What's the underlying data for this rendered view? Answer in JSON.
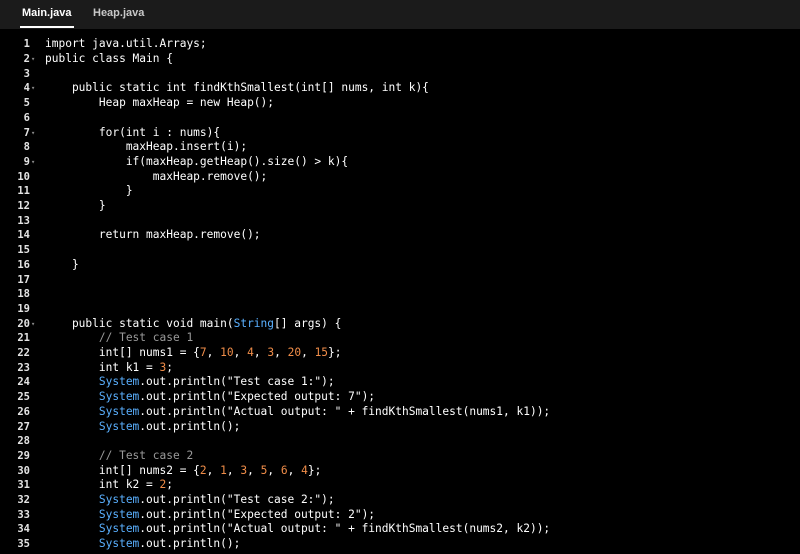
{
  "tabs": [
    {
      "label": "Main.java",
      "active": true
    },
    {
      "label": "Heap.java",
      "active": false
    }
  ],
  "colors": {
    "background": "#000000",
    "tabbar": "#1b1b1b",
    "number": "#f08d49",
    "type": "#5ab0ff",
    "comment": "#9a9a9a"
  },
  "editor": {
    "lines": [
      {
        "n": "1",
        "fold": false,
        "tokens": [
          [
            "plain",
            "import java.util.Arrays;"
          ]
        ]
      },
      {
        "n": "2",
        "fold": true,
        "tokens": [
          [
            "plain",
            "public class Main {"
          ]
        ]
      },
      {
        "n": "3",
        "fold": false,
        "tokens": []
      },
      {
        "n": "4",
        "fold": true,
        "tokens": [
          [
            "plain",
            "    public static int findKthSmallest(int[] nums, int k){"
          ]
        ]
      },
      {
        "n": "5",
        "fold": false,
        "tokens": [
          [
            "plain",
            "        Heap maxHeap = new Heap();"
          ]
        ]
      },
      {
        "n": "6",
        "fold": false,
        "tokens": []
      },
      {
        "n": "7",
        "fold": true,
        "tokens": [
          [
            "plain",
            "        for(int i : nums){"
          ]
        ]
      },
      {
        "n": "8",
        "fold": false,
        "tokens": [
          [
            "plain",
            "            maxHeap.insert(i);"
          ]
        ]
      },
      {
        "n": "9",
        "fold": true,
        "tokens": [
          [
            "plain",
            "            if(maxHeap.getHeap().size() > k){"
          ]
        ]
      },
      {
        "n": "10",
        "fold": false,
        "tokens": [
          [
            "plain",
            "                maxHeap.remove();"
          ]
        ]
      },
      {
        "n": "11",
        "fold": false,
        "tokens": [
          [
            "plain",
            "            }"
          ]
        ]
      },
      {
        "n": "12",
        "fold": false,
        "tokens": [
          [
            "plain",
            "        }"
          ]
        ]
      },
      {
        "n": "13",
        "fold": false,
        "tokens": []
      },
      {
        "n": "14",
        "fold": false,
        "tokens": [
          [
            "plain",
            "        return maxHeap.remove();"
          ]
        ]
      },
      {
        "n": "15",
        "fold": false,
        "tokens": []
      },
      {
        "n": "16",
        "fold": false,
        "tokens": [
          [
            "plain",
            "    }"
          ]
        ]
      },
      {
        "n": "17",
        "fold": false,
        "tokens": []
      },
      {
        "n": "18",
        "fold": false,
        "tokens": []
      },
      {
        "n": "19",
        "fold": false,
        "tokens": []
      },
      {
        "n": "20",
        "fold": true,
        "tokens": [
          [
            "plain",
            "    public static void main("
          ],
          [
            "type",
            "String"
          ],
          [
            "plain",
            "[] args) {"
          ]
        ]
      },
      {
        "n": "21",
        "fold": false,
        "tokens": [
          [
            "com",
            "        // Test case 1"
          ]
        ]
      },
      {
        "n": "22",
        "fold": false,
        "tokens": [
          [
            "plain",
            "        int[] nums1 = {"
          ],
          [
            "num",
            "7"
          ],
          [
            "plain",
            ", "
          ],
          [
            "num",
            "10"
          ],
          [
            "plain",
            ", "
          ],
          [
            "num",
            "4"
          ],
          [
            "plain",
            ", "
          ],
          [
            "num",
            "3"
          ],
          [
            "plain",
            ", "
          ],
          [
            "num",
            "20"
          ],
          [
            "plain",
            ", "
          ],
          [
            "num",
            "15"
          ],
          [
            "plain",
            "};"
          ]
        ]
      },
      {
        "n": "23",
        "fold": false,
        "tokens": [
          [
            "plain",
            "        int k1 = "
          ],
          [
            "num",
            "3"
          ],
          [
            "plain",
            ";"
          ]
        ]
      },
      {
        "n": "24",
        "fold": false,
        "tokens": [
          [
            "type",
            "        System"
          ],
          [
            "plain",
            ".out.println(\"Test case 1:\");"
          ]
        ]
      },
      {
        "n": "25",
        "fold": false,
        "tokens": [
          [
            "type",
            "        System"
          ],
          [
            "plain",
            ".out.println(\"Expected output: 7\");"
          ]
        ]
      },
      {
        "n": "26",
        "fold": false,
        "tokens": [
          [
            "type",
            "        System"
          ],
          [
            "plain",
            ".out.println(\"Actual output: \" + findKthSmallest(nums1, k1));"
          ]
        ]
      },
      {
        "n": "27",
        "fold": false,
        "tokens": [
          [
            "type",
            "        System"
          ],
          [
            "plain",
            ".out.println();"
          ]
        ]
      },
      {
        "n": "28",
        "fold": false,
        "tokens": []
      },
      {
        "n": "29",
        "fold": false,
        "tokens": [
          [
            "com",
            "        // Test case 2"
          ]
        ]
      },
      {
        "n": "30",
        "fold": false,
        "tokens": [
          [
            "plain",
            "        int[] nums2 = {"
          ],
          [
            "num",
            "2"
          ],
          [
            "plain",
            ", "
          ],
          [
            "num",
            "1"
          ],
          [
            "plain",
            ", "
          ],
          [
            "num",
            "3"
          ],
          [
            "plain",
            ", "
          ],
          [
            "num",
            "5"
          ],
          [
            "plain",
            ", "
          ],
          [
            "num",
            "6"
          ],
          [
            "plain",
            ", "
          ],
          [
            "num",
            "4"
          ],
          [
            "plain",
            "};"
          ]
        ]
      },
      {
        "n": "31",
        "fold": false,
        "tokens": [
          [
            "plain",
            "        int k2 = "
          ],
          [
            "num",
            "2"
          ],
          [
            "plain",
            ";"
          ]
        ]
      },
      {
        "n": "32",
        "fold": false,
        "tokens": [
          [
            "type",
            "        System"
          ],
          [
            "plain",
            ".out.println(\"Test case 2:\");"
          ]
        ]
      },
      {
        "n": "33",
        "fold": false,
        "tokens": [
          [
            "type",
            "        System"
          ],
          [
            "plain",
            ".out.println(\"Expected output: 2\");"
          ]
        ]
      },
      {
        "n": "34",
        "fold": false,
        "tokens": [
          [
            "type",
            "        System"
          ],
          [
            "plain",
            ".out.println(\"Actual output: \" + findKthSmallest(nums2, k2));"
          ]
        ]
      },
      {
        "n": "35",
        "fold": false,
        "tokens": [
          [
            "type",
            "        System"
          ],
          [
            "plain",
            ".out.println();"
          ]
        ]
      }
    ]
  }
}
